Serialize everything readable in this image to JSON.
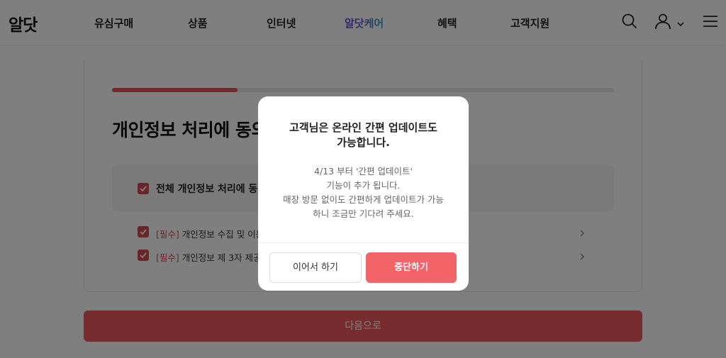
{
  "header": {
    "logo": "알닷",
    "nav": [
      "유심구매",
      "상품",
      "인터넷",
      "알닷케어",
      "혜택",
      "고객지원"
    ],
    "active_nav": "알닷케어"
  },
  "page": {
    "progress": 0.25,
    "title": "개인정보 처리에 동의",
    "agree_all": "전체 개인정보 처리에 동의",
    "terms": [
      {
        "required": "[필수]",
        "label": "개인정보 수집 및 이용"
      },
      {
        "required": "[필수]",
        "label": "개인정보 제 3자 제공"
      }
    ],
    "next_button": "다음으로"
  },
  "modal": {
    "title_line1": "고객님은 온라인 간편 업데이트도",
    "title_line2": "가능합니다.",
    "message_lines": [
      "4/13 부터 '간편 업데이트'",
      "기능이 추가 됩니다.",
      "매장 방문 없이도 간편하게 업데이트가 가능",
      "하니 조금만 기다려 주세요."
    ],
    "continue_button": "이어서 하기",
    "stop_button": "중단하기"
  },
  "colors": {
    "accent": "#e2545d",
    "stop_button": "#f26468",
    "overlay": "rgba(0,0,0,0.5)"
  }
}
